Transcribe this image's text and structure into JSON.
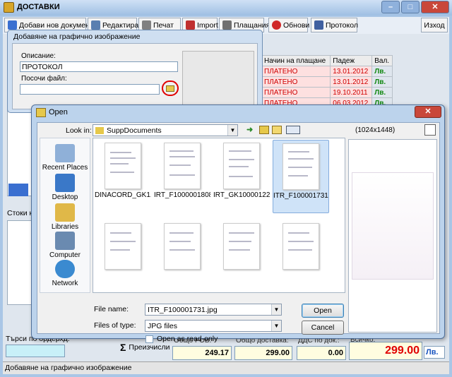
{
  "window": {
    "title": "ДОСТАВКИ"
  },
  "toolbar": {
    "buttons": [
      "Добави нов документ",
      "Редактирай",
      "Печат",
      "Import",
      "Плащания",
      "Обнови",
      "Протокол"
    ],
    "exit": "Изход"
  },
  "grid": {
    "headers": [
      "Начин на плащане",
      "Падеж",
      "Вал."
    ],
    "rows": [
      [
        "ПЛАТЕНО",
        "13.01.2012",
        "Лв."
      ],
      [
        "ПЛАТЕНО",
        "13.01.2012",
        "Лв."
      ],
      [
        "ПЛАТЕНО",
        "19.10.2011",
        "Лв."
      ],
      [
        "ПЛАТЕНО",
        "06.03.2012",
        "Лв."
      ]
    ]
  },
  "image_dialog": {
    "title": "Добавяне на графично изображение",
    "description_label": "Описание:",
    "description_value": "ПРОТОКОЛ",
    "file_label": "Посочи файл:",
    "file_value": ""
  },
  "open_dialog": {
    "title": "Open",
    "look_in_label": "Look in:",
    "look_in_value": "SuppDocuments",
    "preview_size": "(1024x1448)",
    "places": [
      "Recent Places",
      "Desktop",
      "Libraries",
      "Computer",
      "Network"
    ],
    "files": [
      {
        "name": "DINACORD_GK1...",
        "selected": false
      },
      {
        "name": "IRT_F1000001808....",
        "selected": false
      },
      {
        "name": "IRT_GK100001229...",
        "selected": false
      },
      {
        "name": "ITR_F100001731.jpg",
        "selected": true
      }
    ],
    "file_name_label": "File name:",
    "file_name_value": "ITR_F100001731.jpg",
    "files_of_type_label": "Files of type:",
    "files_of_type_value": "JPG files",
    "readonly_label": "Open as read-only",
    "open_button": "Open",
    "cancel_button": "Cancel"
  },
  "bottom": {
    "search_label": "Търси по ордерхд:",
    "recalc_label": "Преизчисли",
    "fob_label": "Общо FOB:",
    "fob_value": "249.17",
    "delivery_label": "Общо доставка:",
    "delivery_value": "299.00",
    "vat_label": "ДДС по док.:",
    "vat_value": "0.00",
    "total_label": "Всичко:",
    "total_value": "299.00",
    "currency": "Лв.",
    "side_label": "Стоки к"
  },
  "status": {
    "text": "Добавяне на графично изображение"
  }
}
